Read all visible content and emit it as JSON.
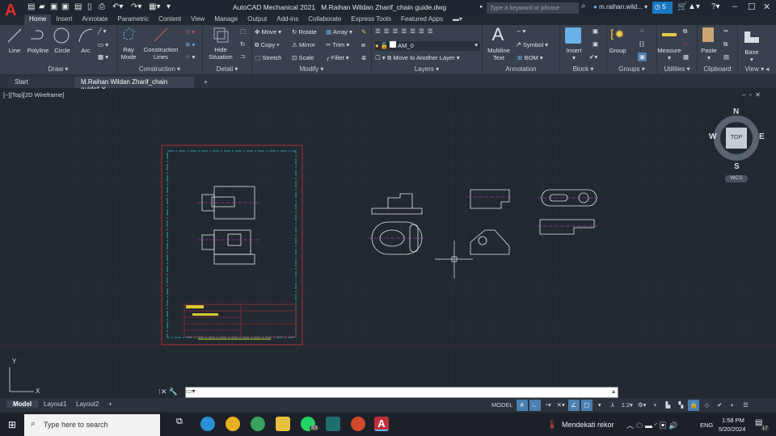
{
  "app": {
    "title": "AutoCAD Mechanical 2021",
    "document": "M.Raihan Wildan Zharif_chain guide.dwg",
    "logo": "A",
    "search_placeholder": "Type a keyword or phrase",
    "user": "m.raihan.wild...",
    "notifications": "5"
  },
  "menu_tabs": [
    "Home",
    "Insert",
    "Annotate",
    "Parametric",
    "Content",
    "View",
    "Manage",
    "Output",
    "Add-ins",
    "Collaborate",
    "Express Tools",
    "Featured Apps"
  ],
  "ribbon": {
    "draw": {
      "title": "Draw",
      "line": "Line",
      "polyline": "Polyline",
      "circle": "Circle",
      "arc": "Arc"
    },
    "construction": {
      "title": "Construction",
      "ray": "Ray",
      "mode": "Mode",
      "construction": "Construction",
      "lines": "Lines"
    },
    "detail": {
      "title": "Detail",
      "hide": "Hide",
      "situation": "Situation"
    },
    "modify": {
      "title": "Modify",
      "move": "Move",
      "rotate": "Rotate",
      "array": "Array",
      "copy": "Copy",
      "mirror": "Mirror",
      "trim": "Trim",
      "stretch": "Stretch",
      "scale": "Scale",
      "fillet": "Fillet"
    },
    "layers": {
      "title": "Layers",
      "current": "AM_0",
      "move_layer": "Move to Another Layer"
    },
    "annotation": {
      "title": "Annotation",
      "multiline": "Multiline",
      "text": "Text",
      "symbol": "Symbol",
      "bom": "BOM"
    },
    "block": {
      "title": "Block",
      "insert": "Insert"
    },
    "groups": {
      "title": "Groups",
      "group": "Group"
    },
    "utilities": {
      "title": "Utilities",
      "measure": "Measure"
    },
    "clipboard": {
      "title": "Clipboard",
      "paste": "Paste"
    },
    "view": {
      "title": "View",
      "base": "Base"
    }
  },
  "file_tabs": {
    "start": "Start",
    "drawing": "M.Raihan Wildan Zharif_chain guide*"
  },
  "viewport": {
    "label": "[−][Top][2D Wireframe]",
    "viewcube": {
      "top": "TOP",
      "n": "N",
      "s": "S",
      "e": "E",
      "w": "W",
      "wcs": "WCS"
    },
    "ucs_y": "Y",
    "ucs_x": "X",
    "title_block_text": [
      "GUIDE BLOCK",
      "BLOCK BESAI SENTRIS"
    ]
  },
  "layout_tabs": [
    "Model",
    "Layout1",
    "Layout2"
  ],
  "status": {
    "model": "MODEL",
    "scale": "1:2"
  },
  "taskbar": {
    "search": "Type here to search",
    "weather": "Mendekati rekor",
    "lang": "ENG",
    "time": "1:58 PM",
    "date": "5/20/2024",
    "whatsapp_badge": "83",
    "notif_count": "17"
  }
}
